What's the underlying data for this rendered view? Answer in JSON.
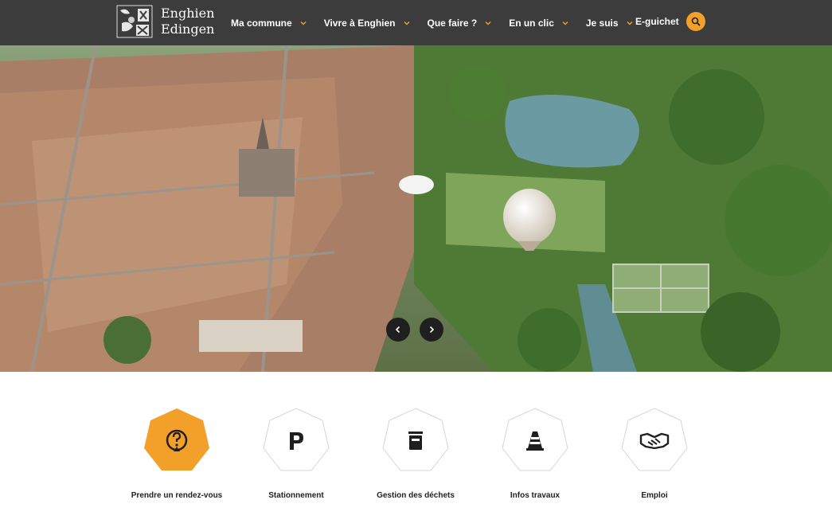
{
  "header": {
    "logo": {
      "line1": "Enghien",
      "line2": "Edingen"
    },
    "nav": [
      {
        "label": "Ma commune"
      },
      {
        "label": "Vivre à Enghien"
      },
      {
        "label": "Que faire ?"
      },
      {
        "label": "En un clic"
      },
      {
        "label": "Je suis"
      }
    ],
    "eguichet": "E-guichet",
    "search_icon": "search-icon"
  },
  "hero": {
    "prev_icon": "chevron-left-icon",
    "next_icon": "chevron-right-icon"
  },
  "quick_links": [
    {
      "label": "Prendre un rendez-vous",
      "icon": "appointment-question-icon",
      "active": true
    },
    {
      "label": "Stationnement",
      "icon": "parking-icon",
      "active": false
    },
    {
      "label": "Gestion des déchets",
      "icon": "trash-bin-icon",
      "active": false
    },
    {
      "label": "Infos travaux",
      "icon": "traffic-cone-icon",
      "active": false
    },
    {
      "label": "Emploi",
      "icon": "handshake-icon",
      "active": false
    }
  ],
  "colors": {
    "header_bg": "#3c3c3c",
    "accent": "#f3a02b",
    "text": "#222222"
  }
}
